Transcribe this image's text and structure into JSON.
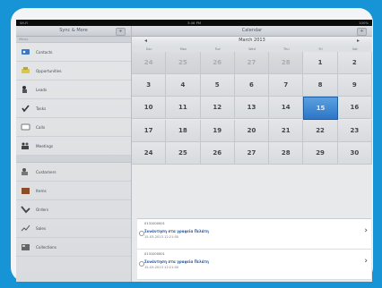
{
  "statusbar": {
    "left": "Wi-Fi",
    "center": "3:46 PM",
    "right": "100%"
  },
  "sidebar": {
    "title": "Sync & More",
    "edit_label": "+",
    "section1": "Menu",
    "items": [
      {
        "label": "Contacts",
        "icon": "contacts-icon"
      },
      {
        "label": "Opportunities",
        "icon": "opportunities-icon"
      },
      {
        "label": "Leads",
        "icon": "leads-icon"
      },
      {
        "label": "Tasks",
        "icon": "tasks-icon"
      },
      {
        "label": "Calls",
        "icon": "calls-icon"
      },
      {
        "label": "Meetings",
        "icon": "meetings-icon"
      }
    ],
    "items2": [
      {
        "label": "Customers",
        "icon": "customers-icon"
      },
      {
        "label": "Items",
        "icon": "items-icon"
      },
      {
        "label": "Orders",
        "icon": "orders-icon"
      },
      {
        "label": "Sales",
        "icon": "sales-icon"
      },
      {
        "label": "Collections",
        "icon": "collections-icon"
      }
    ]
  },
  "main": {
    "title": "Calendar",
    "add_label": "+",
    "month": "March 2013",
    "prev_label": "◂",
    "next_label": "▸",
    "weekdays": [
      "Sun",
      "Mon",
      "Tue",
      "Wed",
      "Thu",
      "Fri",
      "Sat"
    ],
    "days": [
      {
        "d": "24",
        "o": true
      },
      {
        "d": "25",
        "o": true
      },
      {
        "d": "26",
        "o": true
      },
      {
        "d": "27",
        "o": true
      },
      {
        "d": "28",
        "o": true
      },
      {
        "d": "1"
      },
      {
        "d": "2"
      },
      {
        "d": "3"
      },
      {
        "d": "4"
      },
      {
        "d": "5"
      },
      {
        "d": "6"
      },
      {
        "d": "7"
      },
      {
        "d": "8"
      },
      {
        "d": "9"
      },
      {
        "d": "10"
      },
      {
        "d": "11"
      },
      {
        "d": "12"
      },
      {
        "d": "13"
      },
      {
        "d": "14"
      },
      {
        "d": "15",
        "t": true
      },
      {
        "d": "16"
      },
      {
        "d": "17"
      },
      {
        "d": "18"
      },
      {
        "d": "19"
      },
      {
        "d": "20"
      },
      {
        "d": "21"
      },
      {
        "d": "22"
      },
      {
        "d": "23"
      },
      {
        "d": "24"
      },
      {
        "d": "25"
      },
      {
        "d": "26"
      },
      {
        "d": "27"
      },
      {
        "d": "28"
      },
      {
        "d": "29"
      },
      {
        "d": "30"
      }
    ],
    "events": [
      {
        "code": "0131000001",
        "name": "Συνάντηση στα γραφεία Πελάτη",
        "date": "15-03-2013 12:21:00"
      },
      {
        "code": "0131000001",
        "name": "Συνάντηση στα γραφεία Πελάτη",
        "date": "15-03-2013 12:21:00"
      }
    ]
  },
  "colors": {
    "today": "#2d76c6",
    "background": "#1794d6"
  }
}
